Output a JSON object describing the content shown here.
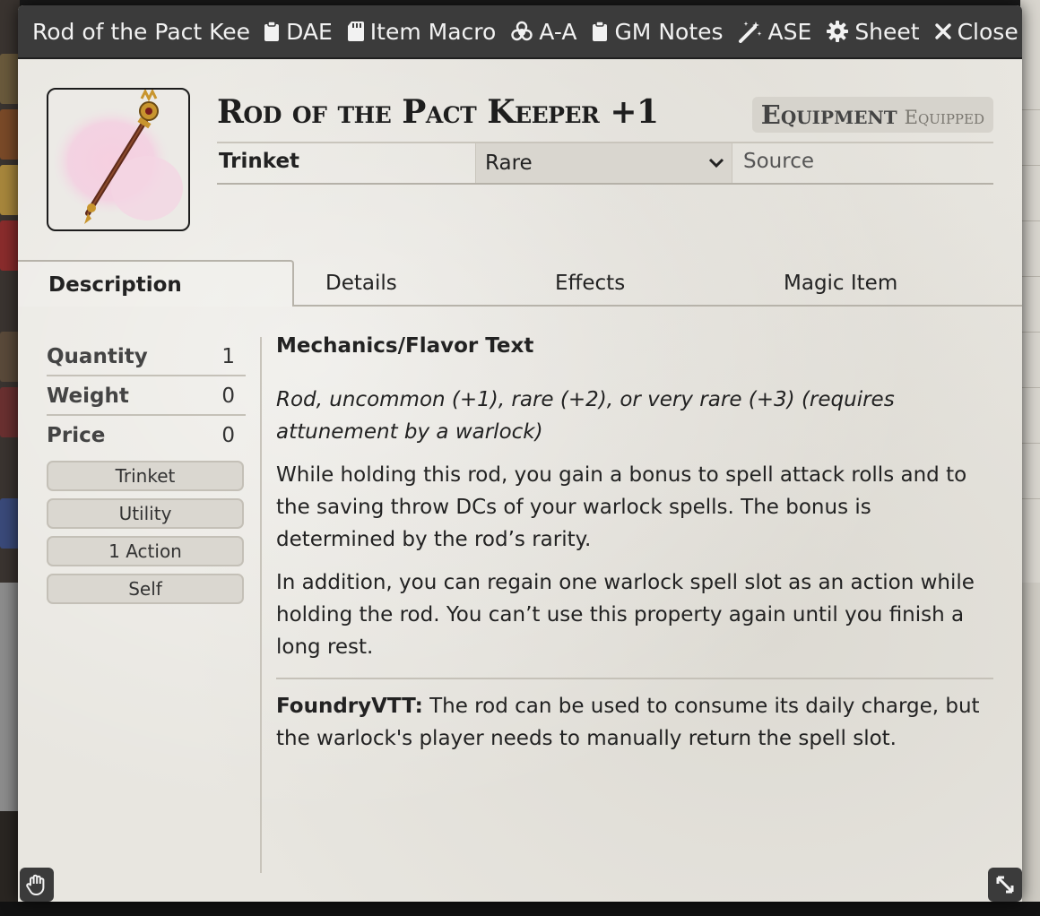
{
  "window": {
    "title": "Rod of the Pact Kee",
    "header_buttons": [
      {
        "label": "DAE",
        "icon": "clipboard-icon"
      },
      {
        "label": "Item Macro",
        "icon": "sd-card-icon"
      },
      {
        "label": "A-A",
        "icon": "biohazard-icon"
      },
      {
        "label": "GM Notes",
        "icon": "clipboard-icon"
      },
      {
        "label": "ASE",
        "icon": "magic-wand-icon"
      },
      {
        "label": "Sheet",
        "icon": "gear-icon"
      },
      {
        "label": "Close",
        "icon": "close-icon"
      }
    ]
  },
  "item": {
    "name": "Rod of the Pact Keeper +1",
    "type_label": "Equipment",
    "status_label": "Equipped",
    "subtype": "Trinket",
    "rarity": "Rare",
    "source_placeholder": "Source"
  },
  "tabs": [
    {
      "label": "Description",
      "active": true
    },
    {
      "label": "Details",
      "active": false
    },
    {
      "label": "Effects",
      "active": false
    },
    {
      "label": "Magic Item",
      "active": false
    }
  ],
  "sidebar": {
    "stats": [
      {
        "label": "Quantity",
        "value": "1"
      },
      {
        "label": "Weight",
        "value": "0"
      },
      {
        "label": "Price",
        "value": "0"
      }
    ],
    "pills": [
      "Trinket",
      "Utility",
      "1 Action",
      "Self"
    ]
  },
  "description": {
    "heading": "Mechanics/Flavor Text",
    "flavor": "Rod, uncommon (+1), rare (+2), or very rare (+3) (requires attunement by a warlock)",
    "para1": "While holding this rod, you gain a bonus to spell attack rolls and to the saving throw DCs of your warlock spells. The bonus is determined by the rod’s rarity.",
    "para2": "In addition, you can regain one warlock spell slot as an action while holding the rod. You can’t use this property again until you finish a long rest.",
    "note_label": "FoundryVTT:",
    "note_text": " The rod can be used to consume its daily charge, but the warlock's player needs to manually return the spell slot."
  },
  "colors": {
    "titlebar": "#3b3b3b",
    "sheet_bg": "#e8e6e0",
    "rod_gold": "#b8862c",
    "rod_shaft": "#6b2e1e"
  }
}
